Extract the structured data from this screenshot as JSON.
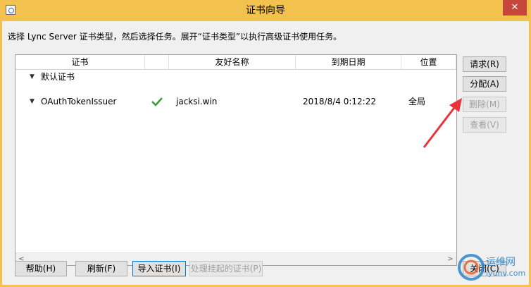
{
  "window": {
    "title": "证书向导",
    "close_glyph": "✕"
  },
  "instruction": "选择 Lync Server 证书类型，然后选择任务。展开“证书类型”以执行高级证书使用任务。",
  "table": {
    "columns": [
      "证书",
      "",
      "友好名称",
      "到期日期",
      "位置"
    ],
    "group_label": "默认证书",
    "rows": [
      {
        "certificate": "OAuthTokenIssuer",
        "status_icon": "green-check-icon",
        "friendly_name": "jacksi.win",
        "expiry": "2018/8/4 0:12:22",
        "location": "全局"
      }
    ]
  },
  "side_buttons": {
    "request": "请求(R)",
    "assign": "分配(A)",
    "remove": "删除(M)",
    "view": "查看(V)"
  },
  "bottom_buttons": {
    "help": "帮助(H)",
    "refresh": "刷新(F)",
    "import": "导入证书(I)",
    "pending": "处理挂起的证书(P)",
    "close": "关闭(C)"
  },
  "watermark": {
    "text": "运维网",
    "domain": "iyunv.com"
  },
  "colors": {
    "title_bar": "#f2c14e",
    "close_button": "#c7463c",
    "annotation_arrow": "#e8343a",
    "check": "#3a9a34"
  }
}
